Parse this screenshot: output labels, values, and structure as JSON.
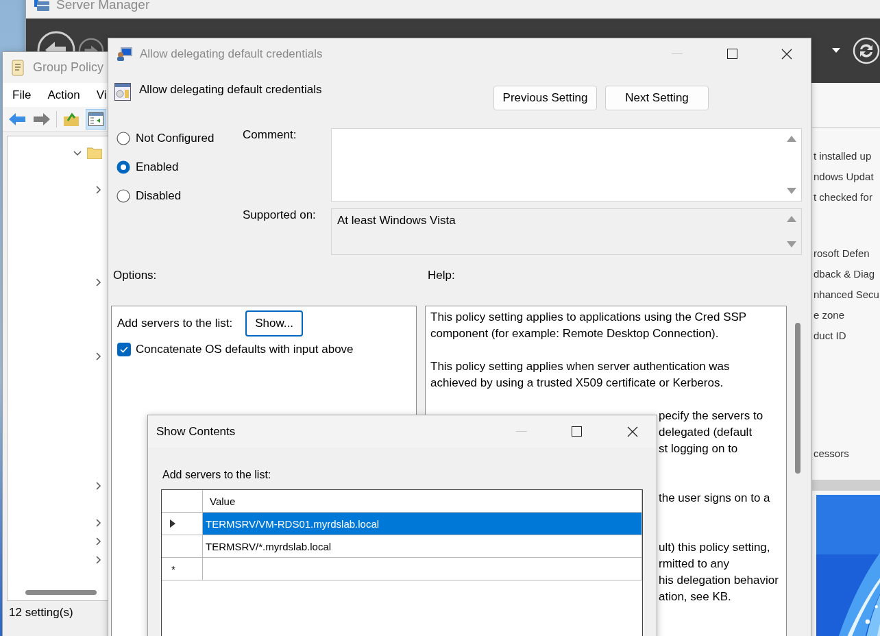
{
  "server_manager": {
    "title": "Server Manager",
    "active": false,
    "detail_groups": [
      [
        "t installed up",
        "ndows Updat",
        "t checked for"
      ],
      [
        "rosoft Defen",
        "dback & Diag",
        "nhanced Secu",
        "e zone",
        "duct ID"
      ],
      [
        "cessors"
      ]
    ]
  },
  "group_policy": {
    "title": "Group Policy",
    "active": false,
    "menu": [
      "File",
      "Action",
      "Vi"
    ],
    "tree_toggle_pressed": true,
    "tree": [
      {
        "expandable": true,
        "expanded": true
      },
      {
        "expandable": false,
        "expanded": false
      },
      {
        "expandable": true,
        "expanded": false
      },
      {
        "expandable": false,
        "expanded": false
      },
      {
        "expandable": false,
        "expanded": false
      },
      {
        "expandable": false,
        "expanded": false
      },
      {
        "expandable": false,
        "expanded": false
      },
      {
        "expandable": true,
        "expanded": false
      },
      {
        "expandable": false,
        "expanded": false
      },
      {
        "expandable": false,
        "expanded": false
      },
      {
        "expandable": false,
        "expanded": false
      },
      {
        "expandable": true,
        "expanded": false
      },
      {
        "expandable": false,
        "expanded": false
      },
      {
        "expandable": false,
        "expanded": false
      },
      {
        "expandable": false,
        "expanded": false
      },
      {
        "expandable": false,
        "expanded": false
      },
      {
        "expandable": false,
        "expanded": false
      },
      {
        "expandable": false,
        "expanded": false
      },
      {
        "expandable": true,
        "expanded": false
      },
      {
        "expandable": false,
        "expanded": false
      },
      {
        "expandable": true,
        "expanded": false
      },
      {
        "expandable": true,
        "expanded": false
      },
      {
        "expandable": true,
        "expanded": false
      }
    ],
    "status": "12 setting(s)"
  },
  "policy_dialog": {
    "title": "Allow delegating default credentials",
    "active": false,
    "heading": "Allow delegating default credentials",
    "nav_buttons": [
      "Previous Setting",
      "Next Setting"
    ],
    "states": [
      {
        "label": "Not Configured",
        "selected": false
      },
      {
        "label": "Enabled",
        "selected": true
      },
      {
        "label": "Disabled",
        "selected": false
      }
    ],
    "comment_label": "Comment:",
    "supported_label": "Supported on:",
    "supported_value": "At least Windows Vista",
    "options_label": "Options:",
    "help_label": "Help:",
    "options": {
      "list_label": "Add servers to the list:",
      "show_button": "Show...",
      "concatenate": {
        "label": "Concatenate OS defaults with input above",
        "checked": true
      }
    },
    "help_paragraphs": [
      [
        {
          "kind": "full",
          "text": "This policy setting applies to applications using the Cred SSP"
        },
        {
          "kind": "full",
          "text": "component (for example: Remote Desktop Connection)."
        }
      ],
      [
        {
          "kind": "full",
          "text": "This policy setting applies when server authentication was"
        },
        {
          "kind": "full",
          "text": "achieved by using a trusted X509 certificate or Kerberos."
        }
      ],
      [
        {
          "kind": "tail",
          "text": "pecify the servers to"
        },
        {
          "kind": "tail",
          "text": "delegated (default"
        },
        {
          "kind": "tail",
          "text": "st logging on to"
        }
      ],
      [
        {
          "kind": "tail",
          "text": "the user signs on to a"
        }
      ],
      [
        {
          "kind": "tail",
          "text": "ult) this policy setting,"
        },
        {
          "kind": "tail",
          "text": "rmitted to any"
        },
        {
          "kind": "tail",
          "text": "his delegation behavior"
        },
        {
          "kind": "tail",
          "text": "ation, see KB."
        }
      ]
    ]
  },
  "show_contents": {
    "title": "Show Contents",
    "active": true,
    "label": "Add servers to the list:",
    "column": "Value",
    "rows": [
      {
        "kind": "item",
        "value": "TERMSRV/VM-RDS01.myrdslab.local",
        "selected": true
      },
      {
        "kind": "item",
        "value": "TERMSRV/*.myrdslab.local",
        "selected": false
      },
      {
        "kind": "new",
        "marker": "*",
        "selected": false
      }
    ]
  }
}
